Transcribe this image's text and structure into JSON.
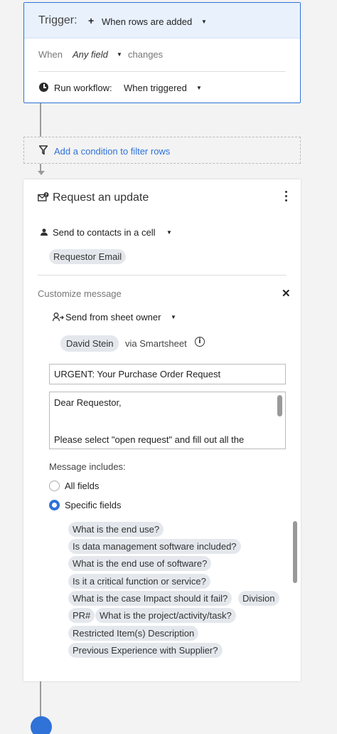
{
  "trigger": {
    "label": "Trigger:",
    "value": "When rows are added",
    "when_label": "When",
    "field_value": "Any field",
    "changes_label": "changes",
    "run_workflow_label": "Run workflow:",
    "run_workflow_value": "When triggered"
  },
  "condition": {
    "label": "Add a condition to filter rows"
  },
  "request": {
    "title": "Request an update",
    "send_to_label": "Send to contacts in a cell",
    "recipient_chip": "Requestor Email",
    "customize_label": "Customize message",
    "send_from_label": "Send from sheet owner",
    "sender_chip": "David Stein",
    "via_label": "via Smartsheet",
    "subject_value": "URGENT: Your Purchase Order Request",
    "body_lines": [
      "Dear Requestor,",
      "Please select \"open request\" and fill out all the"
    ],
    "message_includes_label": "Message includes:",
    "radio_all": "All fields",
    "radio_specific": "Specific fields",
    "selected_option": "Specific fields",
    "fields": [
      "What is the end use?",
      "Is data management software included?",
      "What is the end use of software?",
      "Is it a critical function or service?",
      "What is the case Impact should it fail?",
      "Division",
      "PR#",
      "What is the project/activity/task?",
      "Restricted Item(s) Description",
      "Previous Experience with Supplier?"
    ]
  },
  "colors": {
    "accent": "#2f72d8",
    "trigger_header_bg": "#e8f1fc",
    "chip_bg": "#e4e8ed"
  }
}
